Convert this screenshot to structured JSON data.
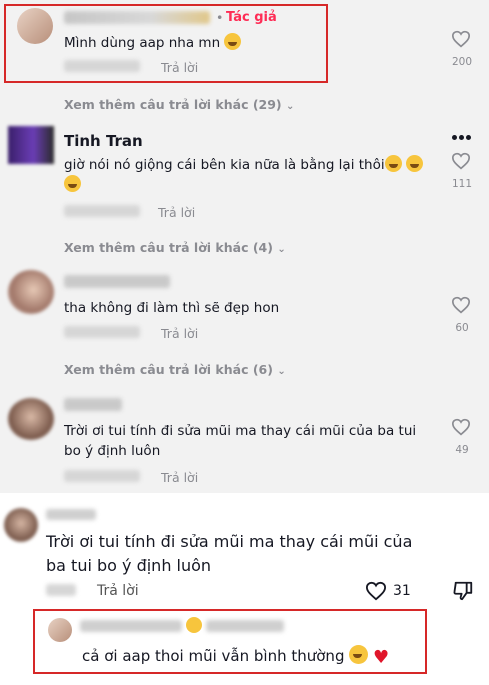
{
  "top_comments": [
    {
      "author": "",
      "author_tag": "Tác giả",
      "separator": "•",
      "text": "Mình dùng aap nha mn",
      "reply_label": "Trả lời",
      "likes": "200"
    },
    {
      "author": "Tinh Tran",
      "text_line1": "giờ nói nó giộng cái bên kia nữa là bằng lại thôi",
      "reply_label": "Trả lời",
      "likes": "111"
    },
    {
      "author": "",
      "text": "tha không đi làm thì sẽ đẹp hon",
      "reply_label": "Trả lời",
      "likes": "60"
    },
    {
      "author": "",
      "text_line1": "Trời ơi tui tính đi sửa mũi ma thay cái mũi của ba tui",
      "text_line2": "bo ý định luôn",
      "reply_label": "Trả lời",
      "likes": "49"
    }
  ],
  "more_replies": [
    "Xem thêm câu trả lời khác (29)",
    "Xem thêm câu trả lời khác (4)",
    "Xem thêm câu trả lời khác (6)"
  ],
  "bottom_comment": {
    "text_line1": "Trời ơi tui tính đi sửa mũi ma thay cái mũi của",
    "text_line2": "ba tui bo ý định luôn",
    "reply_label": "Trả lời",
    "likes": "31",
    "reply": {
      "text": "cả ơi aap thoi mũi vẫn bình thường"
    }
  },
  "colors": {
    "highlight_border": "#d62828",
    "author_tag": "#fe2c55",
    "muted_text": "#8a8b91"
  },
  "icons": [
    "heart-icon",
    "dislike-icon",
    "more-options-icon",
    "chevron-down-icon"
  ]
}
